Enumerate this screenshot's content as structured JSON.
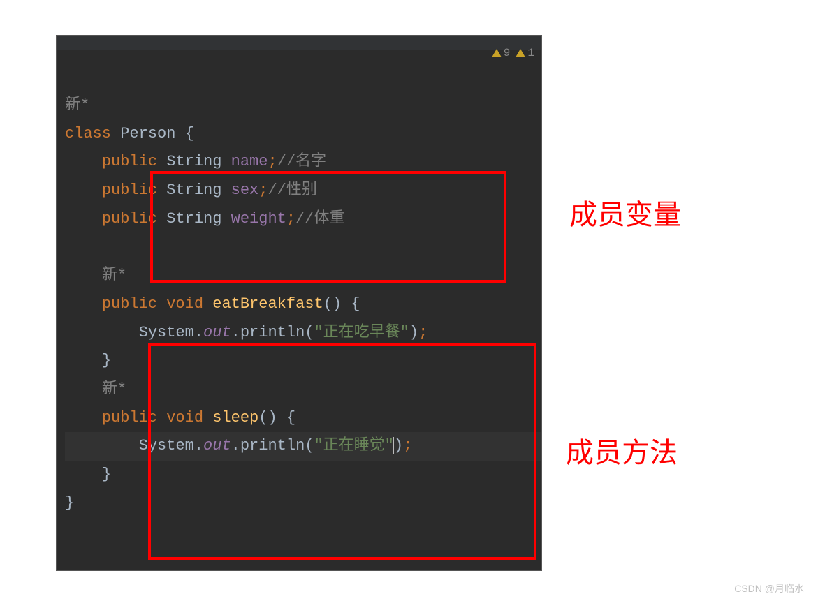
{
  "warnings": {
    "count1": "9",
    "count2": "1"
  },
  "code": {
    "newmark1": "新*",
    "class_kw": "class",
    "classname": "Person",
    "field1": {
      "modifier": "public",
      "type": "String",
      "name": "name",
      "comment": "//名字"
    },
    "field2": {
      "modifier": "public",
      "type": "String",
      "name": "sex",
      "comment": "//性别"
    },
    "field3": {
      "modifier": "public",
      "type": "String",
      "name": "weight",
      "comment": "//体重"
    },
    "newmark2": "新*",
    "method1": {
      "modifier": "public",
      "rettype": "void",
      "name": "eatBreakfast",
      "sys": "System",
      "out": "out",
      "println": "println",
      "str": "\"正在吃早餐\""
    },
    "newmark3": "新*",
    "method2": {
      "modifier": "public",
      "rettype": "void",
      "name": "sleep",
      "sys": "System",
      "out": "out",
      "println": "println",
      "str": "\"正在睡觉\""
    }
  },
  "annotations": {
    "fields": "成员变量",
    "methods": "成员方法"
  },
  "watermark": "CSDN @月临水"
}
